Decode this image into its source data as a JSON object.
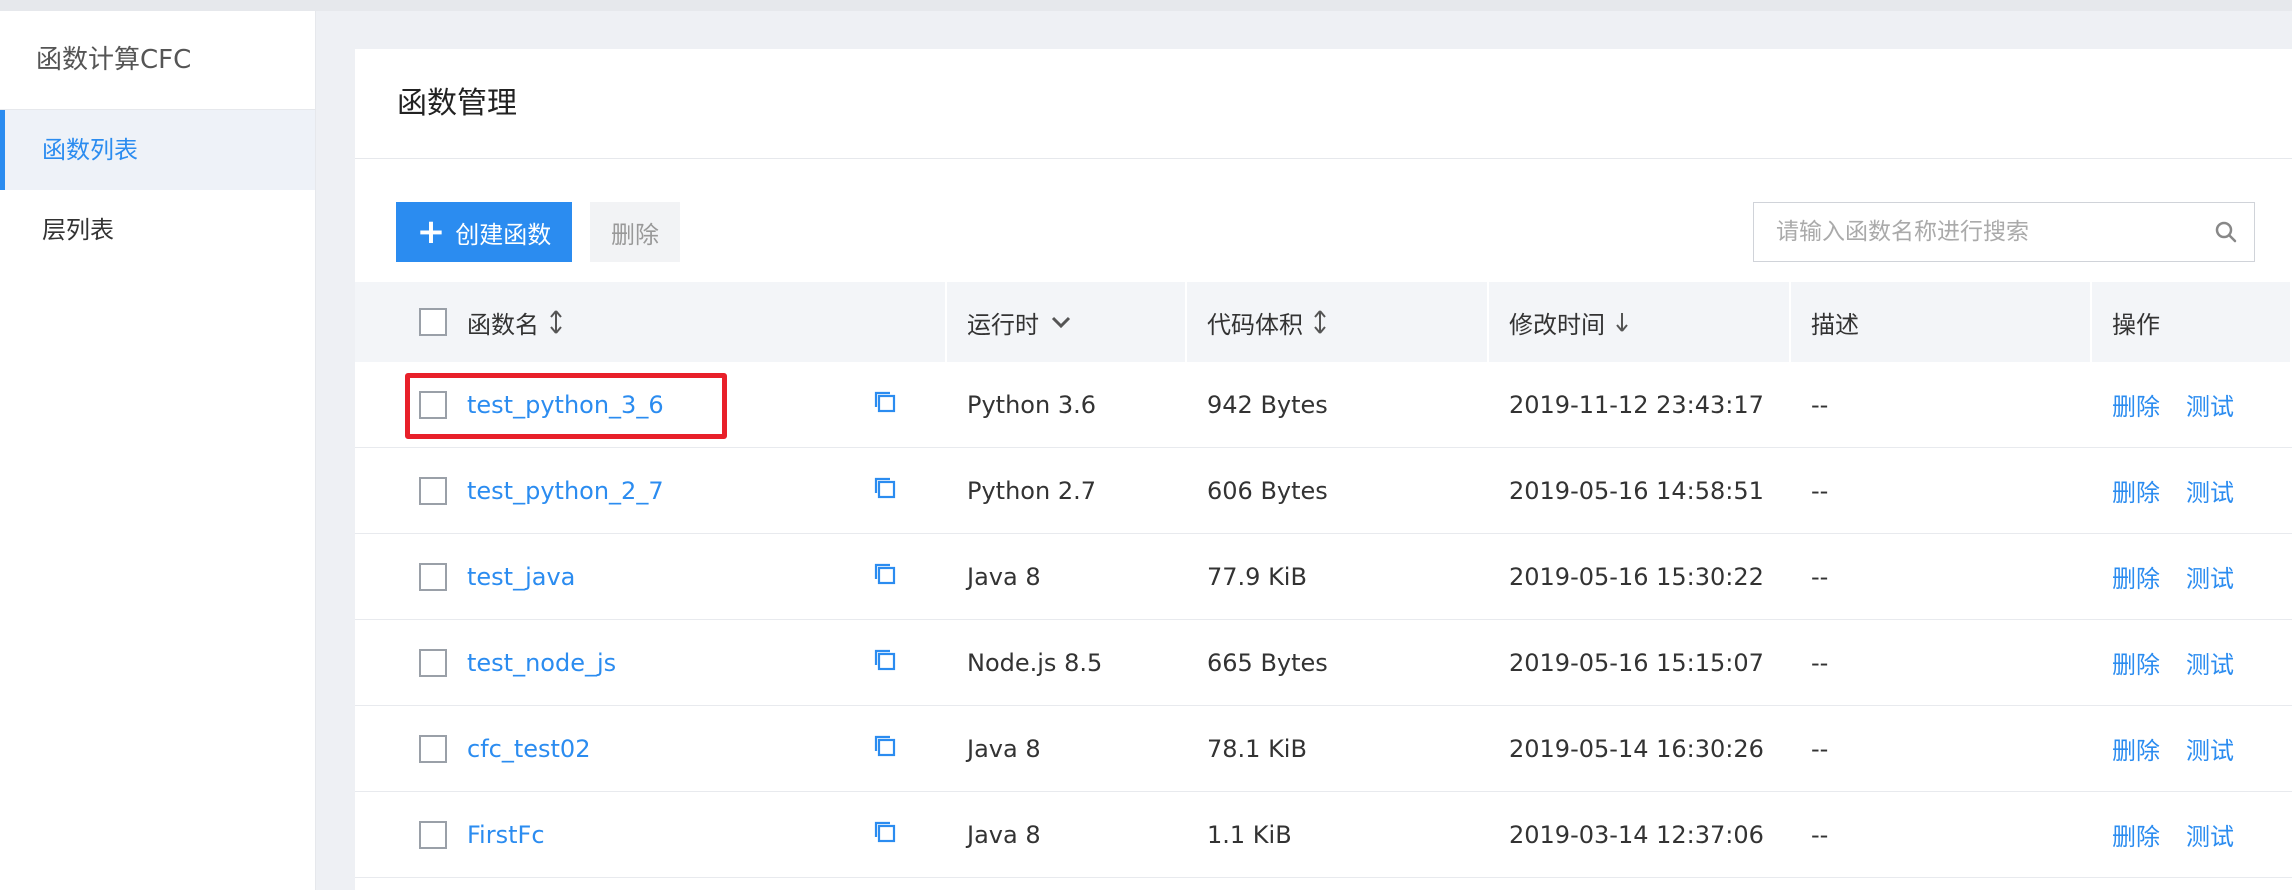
{
  "sidebar": {
    "product": "函数计算CFC",
    "items": [
      {
        "label": "函数列表",
        "active": true
      },
      {
        "label": "层列表",
        "active": false
      }
    ]
  },
  "main": {
    "title": "函数管理",
    "toolbar": {
      "create_label": "创建函数",
      "delete_label": "删除",
      "search_placeholder": "请输入函数名称进行搜索"
    },
    "table": {
      "headers": {
        "name": "函数名",
        "runtime": "运行时",
        "size": "代码体积",
        "modified": "修改时间",
        "desc": "描述",
        "ops": "操作"
      },
      "rows": [
        {
          "name": "test_python_3_6",
          "runtime": "Python 3.6",
          "size": "942 Bytes",
          "modified": "2019-11-12 23:43:17",
          "desc": "--",
          "op_delete": "删除",
          "op_test": "测试"
        },
        {
          "name": "test_python_2_7",
          "runtime": "Python 2.7",
          "size": "606 Bytes",
          "modified": "2019-05-16 14:58:51",
          "desc": "--",
          "op_delete": "删除",
          "op_test": "测试"
        },
        {
          "name": "test_java",
          "runtime": "Java 8",
          "size": "77.9 KiB",
          "modified": "2019-05-16 15:30:22",
          "desc": "--",
          "op_delete": "删除",
          "op_test": "测试"
        },
        {
          "name": "test_node_js",
          "runtime": "Node.js 8.5",
          "size": "665 Bytes",
          "modified": "2019-05-16 15:15:07",
          "desc": "--",
          "op_delete": "删除",
          "op_test": "测试"
        },
        {
          "name": "cfc_test02",
          "runtime": "Java 8",
          "size": "78.1 KiB",
          "modified": "2019-05-14 16:30:26",
          "desc": "--",
          "op_delete": "删除",
          "op_test": "测试"
        },
        {
          "name": "FirstFc",
          "runtime": "Java 8",
          "size": "1.1 KiB",
          "modified": "2019-03-14 12:37:06",
          "desc": "--",
          "op_delete": "删除",
          "op_test": "测试"
        }
      ]
    }
  },
  "colors": {
    "accent": "#2b8cf0",
    "highlight": "#e8202a"
  }
}
